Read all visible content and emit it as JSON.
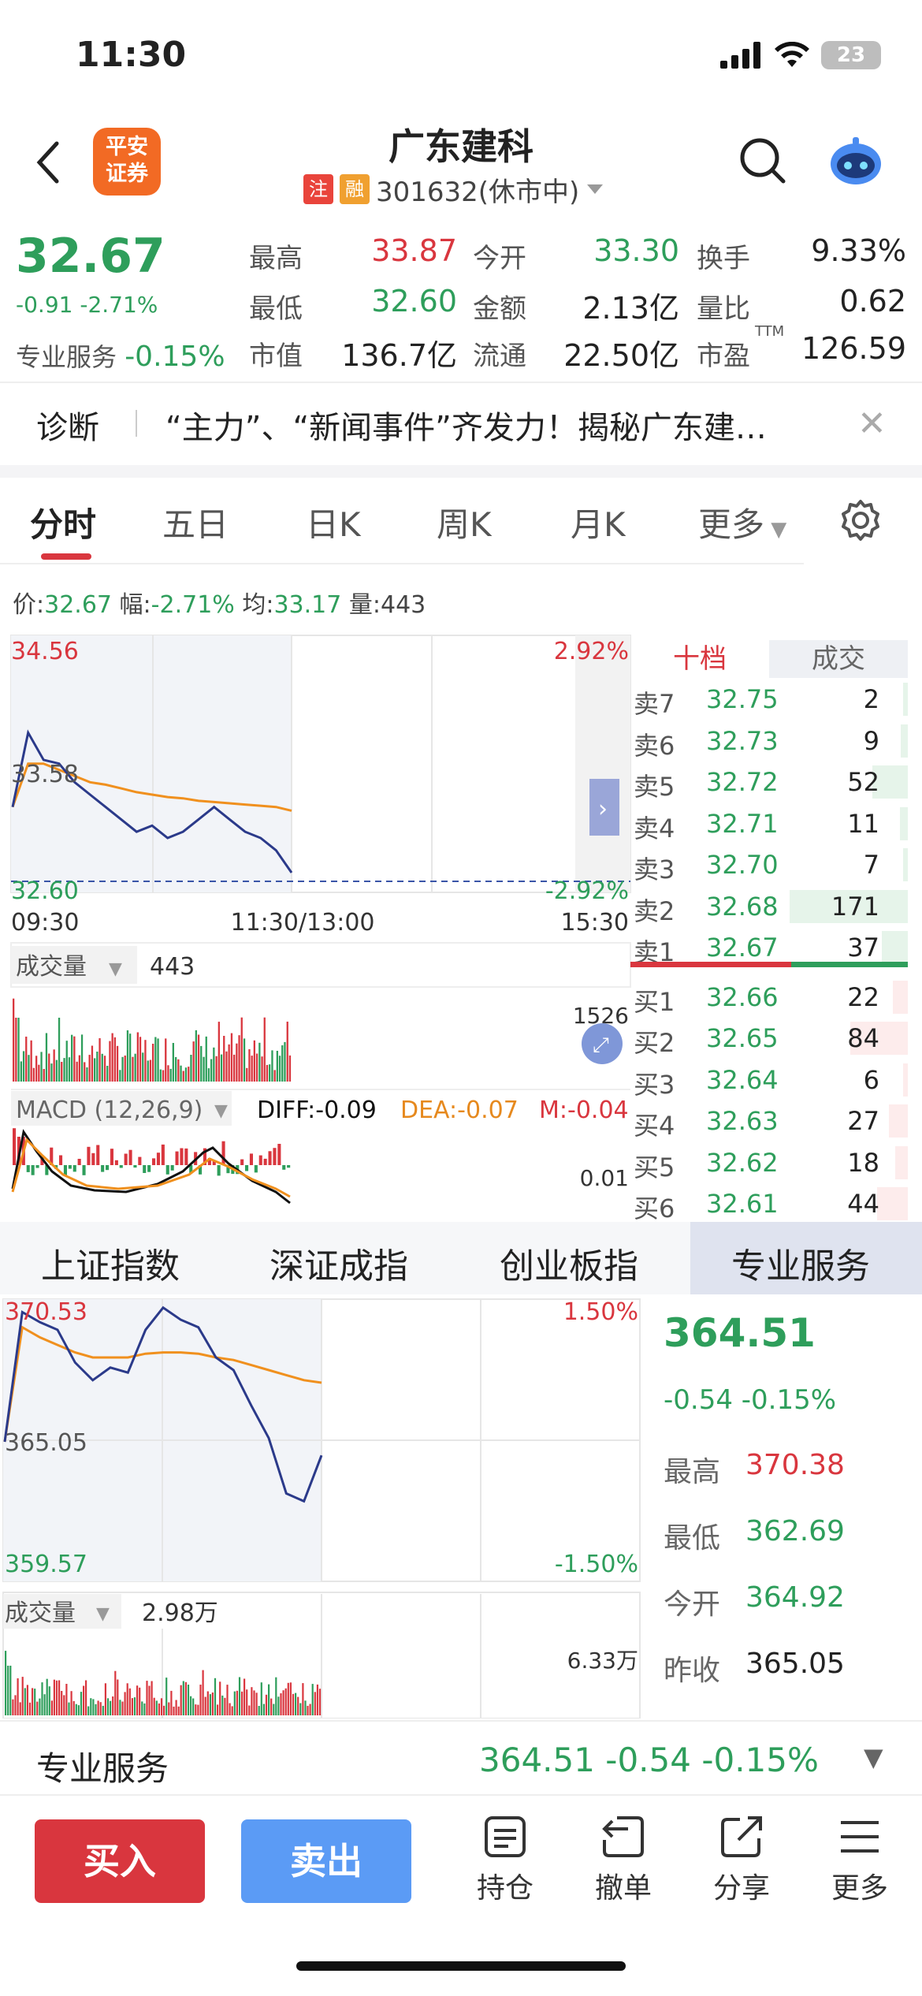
{
  "status_bar": {
    "time": "11:30",
    "battery": "23"
  },
  "header": {
    "stock_name": "广东建科",
    "logo_text_line1": "平安",
    "logo_text_line2": "证券",
    "tag_zhu": "注",
    "tag_rong": "融",
    "code_status": "301632(休市中)",
    "icons": [
      "back-icon",
      "search-icon",
      "robot-assistant-icon"
    ]
  },
  "quote": {
    "price": "32.67",
    "change": "-0.91 -2.71%",
    "sector_label": "专业服务",
    "sector_change": "-0.15%",
    "fields": [
      {
        "label": "最高",
        "value": "33.87",
        "color": "#d9363e"
      },
      {
        "label": "今开",
        "value": "33.30",
        "color": "#2e9e5b"
      },
      {
        "label": "换手",
        "value": "9.33%",
        "color": "#222"
      },
      {
        "label": "最低",
        "value": "32.60",
        "color": "#2e9e5b"
      },
      {
        "label": "金额",
        "value": "2.13亿",
        "color": "#222"
      },
      {
        "label": "量比",
        "value": "0.62",
        "color": "#222"
      },
      {
        "label": "市值",
        "value": "136.7亿",
        "color": "#222"
      },
      {
        "label": "流通",
        "value": "22.50亿",
        "color": "#222"
      },
      {
        "label": "市盈",
        "value": "126.59",
        "color": "#222"
      }
    ],
    "pe_superscript": "TTM"
  },
  "news": {
    "label": "诊断",
    "text": "“主力”、“新闻事件”齐发力！揭秘广东建…"
  },
  "tabs": [
    "分时",
    "五日",
    "日K",
    "周K",
    "月K",
    "更多"
  ],
  "info_line": {
    "price_label": "价:",
    "price": "32.67",
    "amp_label": "幅:",
    "amp": "-2.71%",
    "avg_label": "均:",
    "avg": "33.17",
    "vol_label": "量:",
    "vol": "443"
  },
  "intraday_chart": {
    "y_top": "34.56",
    "y_mid": "33.58",
    "y_bot": "32.60",
    "pct_top": "2.92%",
    "pct_bot": "-2.92%",
    "x_start": "09:30",
    "x_mid": "11:30/13:00",
    "x_end": "15:30",
    "vol_label": "成交量",
    "vol_value": "443",
    "vol_max": "1526",
    "macd_label": "MACD (12,26,9)",
    "diff": "DIFF:-0.09",
    "dea": "DEA:-0.07",
    "m": "M:-0.04",
    "macd_scale": "0.01"
  },
  "chart_data": [
    {
      "type": "line",
      "title": "",
      "xlabel": "",
      "ylabel": "",
      "x": [
        "09:30",
        "11:30/13:00",
        "15:30"
      ],
      "ylim": [
        32.6,
        34.56
      ],
      "series": [
        {
          "values": [
            33.2,
            33.8,
            33.58,
            33.55,
            33.4,
            33.3,
            33.2,
            33.1,
            33.0,
            33.05,
            32.95,
            33.0,
            33.1,
            33.2,
            33.1,
            33.0,
            32.95,
            32.85,
            32.67
          ]
        },
        {
          "values": [
            33.2,
            33.55,
            33.55,
            33.5,
            33.45,
            33.4,
            33.38,
            33.35,
            33.32,
            33.3,
            33.28,
            33.27,
            33.25,
            33.24,
            33.23,
            33.22,
            33.21,
            33.2,
            33.17
          ]
        }
      ]
    },
    {
      "type": "line",
      "title": "",
      "xlabel": "",
      "ylabel": "",
      "ylim": [
        359.57,
        370.53
      ],
      "series": [
        {
          "values": [
            365.05,
            370.2,
            369.8,
            369.5,
            368.2,
            367.5,
            368.0,
            367.8,
            369.5,
            370.38,
            369.9,
            369.6,
            368.4,
            367.9,
            366.5,
            365.2,
            363.0,
            362.69,
            364.51
          ]
        },
        {
          "values": [
            365.05,
            369.6,
            369.2,
            368.9,
            368.6,
            368.4,
            368.4,
            368.4,
            368.55,
            368.6,
            368.6,
            368.55,
            368.4,
            368.3,
            368.1,
            367.9,
            367.7,
            367.5,
            367.4
          ]
        }
      ]
    }
  ],
  "order_book": {
    "tab_ten": "十档",
    "tab_trade": "成交",
    "asks": [
      {
        "label": "卖7",
        "price": "32.75",
        "vol": "2",
        "bar": 0.02
      },
      {
        "label": "卖6",
        "price": "32.73",
        "vol": "9",
        "bar": 0.06
      },
      {
        "label": "卖5",
        "price": "32.72",
        "vol": "52",
        "bar": 0.3
      },
      {
        "label": "卖4",
        "price": "32.71",
        "vol": "11",
        "bar": 0.07
      },
      {
        "label": "卖3",
        "price": "32.70",
        "vol": "7",
        "bar": 0.04
      },
      {
        "label": "卖2",
        "price": "32.68",
        "vol": "171",
        "bar": 1.0
      },
      {
        "label": "卖1",
        "price": "32.67",
        "vol": "37",
        "bar": 0.22
      }
    ],
    "bids": [
      {
        "label": "买1",
        "price": "32.66",
        "vol": "22",
        "bar": 0.13
      },
      {
        "label": "买2",
        "price": "32.65",
        "vol": "84",
        "bar": 0.49
      },
      {
        "label": "买3",
        "price": "32.64",
        "vol": "6",
        "bar": 0.04
      },
      {
        "label": "买4",
        "price": "32.63",
        "vol": "27",
        "bar": 0.16
      },
      {
        "label": "买5",
        "price": "32.62",
        "vol": "18",
        "bar": 0.11
      },
      {
        "label": "买6",
        "price": "32.61",
        "vol": "44",
        "bar": 0.26
      }
    ]
  },
  "index_tabs": [
    "上证指数",
    "深证成指",
    "创业板指",
    "专业服务"
  ],
  "index_chart": {
    "y_top": "370.53",
    "y_mid": "365.05",
    "y_bot": "359.57",
    "pct_top": "1.50%",
    "pct_bot": "-1.50%",
    "vol_label": "成交量",
    "vol_value": "2.98万",
    "vol_max": "6.33万"
  },
  "index_panel": {
    "price": "364.51",
    "change": "-0.54  -0.15%",
    "high_label": "最高",
    "high": "370.38",
    "low_label": "最低",
    "low": "362.69",
    "open_label": "今开",
    "open": "364.92",
    "prev_label": "昨收",
    "prev": "365.05"
  },
  "sector_bar": {
    "name": "专业服务",
    "values": "364.51   -0.54   -0.15%"
  },
  "actions": {
    "buy": "买入",
    "sell": "卖出",
    "hold": "持仓",
    "cancel": "撤单",
    "share": "分享",
    "more": "更多"
  }
}
